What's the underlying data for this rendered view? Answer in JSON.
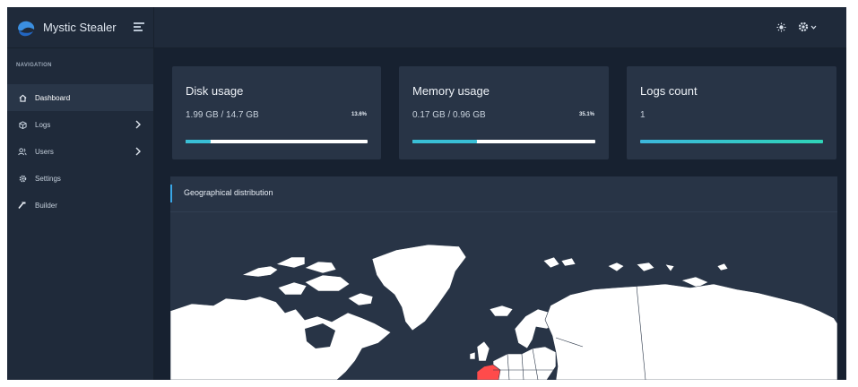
{
  "app": {
    "name": "Mystic Stealer"
  },
  "sidebar": {
    "heading": "NAVIGATION",
    "items": [
      {
        "label": "Dashboard",
        "icon": "home-icon",
        "active": true,
        "has_submenu": false
      },
      {
        "label": "Logs",
        "icon": "cube-icon",
        "active": false,
        "has_submenu": true
      },
      {
        "label": "Users",
        "icon": "users-icon",
        "active": false,
        "has_submenu": true
      },
      {
        "label": "Settings",
        "icon": "gear-icon",
        "active": false,
        "has_submenu": false
      },
      {
        "label": "Builder",
        "icon": "hammer-icon",
        "active": false,
        "has_submenu": false
      }
    ]
  },
  "topbar": {
    "icons": [
      "sun-icon",
      "settings-icon",
      "chevron-down-icon"
    ]
  },
  "cards": {
    "disk": {
      "title": "Disk usage",
      "value": "1.99 GB / 14.7 GB",
      "percent": "13.6%",
      "fill_fraction": 0.136
    },
    "memory": {
      "title": "Memory usage",
      "value": "0.17 GB / 0.96 GB",
      "percent": "35.1%",
      "fill_fraction": 0.351
    },
    "logs": {
      "title": "Logs count",
      "value": "1",
      "fill_fraction": 1.0
    }
  },
  "geo": {
    "title": "Geographical distribution",
    "highlighted_country": "France"
  },
  "colors": {
    "background": "#1e2837",
    "sidebar": "#1f2a3a",
    "card": "#283446",
    "accent": "#39bfd6",
    "highlight": "#ff4b4b"
  }
}
